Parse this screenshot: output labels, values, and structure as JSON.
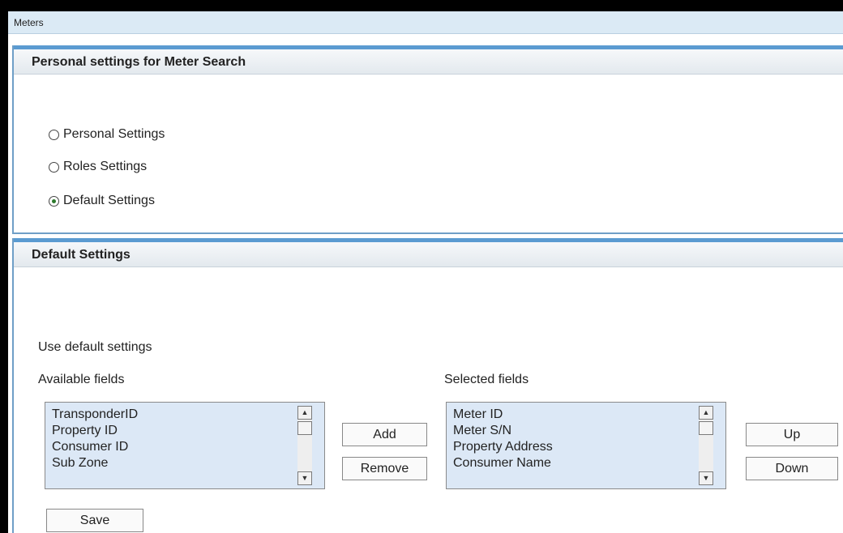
{
  "window": {
    "title": "Meters"
  },
  "personal_section": {
    "header": "Personal settings for Meter Search",
    "options": [
      {
        "label": "Personal Settings",
        "selected": false
      },
      {
        "label": "Roles Settings",
        "selected": false
      },
      {
        "label": "Default Settings",
        "selected": true
      }
    ]
  },
  "default_section": {
    "header": "Default Settings",
    "instruction": "Use default settings",
    "available_label": "Available fields",
    "available_fields": [
      "TransponderID",
      "Property ID",
      "Consumer ID",
      "Sub Zone"
    ],
    "selected_label": "Selected fields",
    "selected_fields": [
      "Meter ID",
      "Meter S/N",
      "Property Address",
      "Consumer Name"
    ],
    "buttons": {
      "add": "Add",
      "remove": "Remove",
      "up": "Up",
      "down": "Down",
      "save": "Save"
    }
  },
  "colors": {
    "accent": "#5b9bd1",
    "listbox_bg": "#dce8f6",
    "titlebar_bg": "#dbeaf5"
  }
}
